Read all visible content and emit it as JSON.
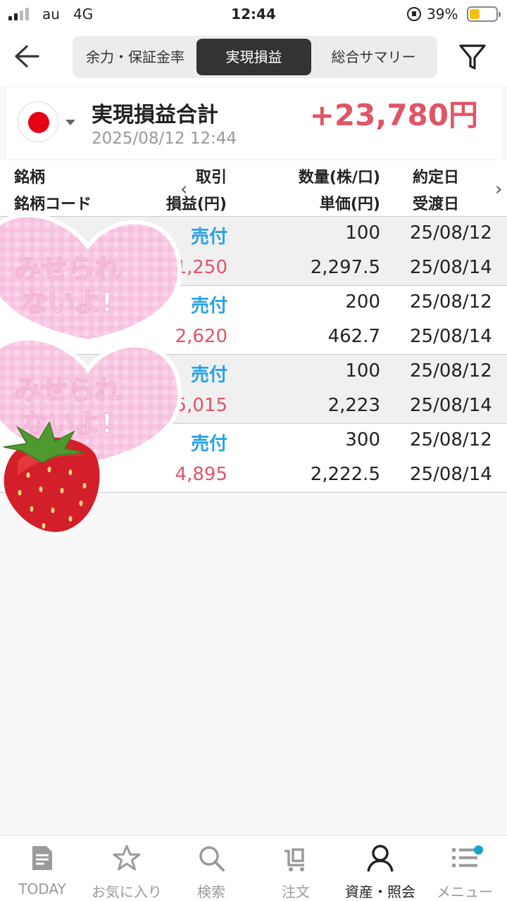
{
  "status_bar": {
    "carrier": "au",
    "network": "4G",
    "time": "12:44",
    "battery": "39%"
  },
  "top_nav": {
    "tabs": [
      {
        "label": "余力・保証金率",
        "active": false
      },
      {
        "label": "実現損益",
        "active": true
      },
      {
        "label": "総合サマリー",
        "active": false
      }
    ]
  },
  "summary": {
    "title": "実現損益合計",
    "datetime": "2025/08/12 12:44",
    "total": "+23,780円"
  },
  "table": {
    "headers": {
      "name": "銘柄",
      "code": "銘柄コード",
      "trade": "取引",
      "pl": "損益(円)",
      "qty": "数量(株/口)",
      "price": "単価(円)",
      "exec_date": "約定日",
      "settle_date": "受渡日"
    },
    "rows": [
      {
        "side": "売付",
        "pl": "1,250",
        "qty": "100",
        "price": "2,297.5",
        "exec": "25/08/12",
        "settle": "25/08/14"
      },
      {
        "side": "売付",
        "pl": "2,620",
        "qty": "200",
        "price": "462.7",
        "exec": "25/08/12",
        "settle": "25/08/14"
      },
      {
        "side": "売付",
        "pl": "15,015",
        "qty": "100",
        "price": "2,223",
        "exec": "25/08/12",
        "settle": "25/08/14"
      },
      {
        "side": "売付",
        "pl": "4,895",
        "qty": "300",
        "price": "2,222.5",
        "exec": "25/08/12",
        "settle": "25/08/14"
      }
    ]
  },
  "sticker": {
    "text_lines": [
      "みせられ",
      "ないよ!"
    ]
  },
  "tab_bar": {
    "items": [
      {
        "label": "TODAY",
        "icon": "document-icon"
      },
      {
        "label": "お気に入り",
        "icon": "star-icon"
      },
      {
        "label": "検索",
        "icon": "search-icon"
      },
      {
        "label": "注文",
        "icon": "cart-icon"
      },
      {
        "label": "資産・照会",
        "icon": "person-icon"
      },
      {
        "label": "メニュー",
        "icon": "list-menu-icon"
      }
    ]
  },
  "colors": {
    "accent_red": "#e05565",
    "sell_blue": "#2aa3e0",
    "active_tab_bg": "#333333",
    "notification_dot": "#16a4c8"
  }
}
